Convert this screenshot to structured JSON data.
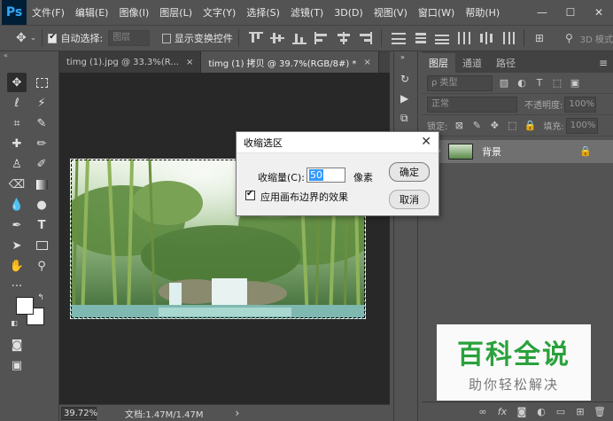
{
  "app": {
    "logo": "Ps"
  },
  "menu": [
    "文件(F)",
    "编辑(E)",
    "图像(I)",
    "图层(L)",
    "文字(Y)",
    "选择(S)",
    "滤镜(T)",
    "3D(D)",
    "视图(V)",
    "窗口(W)",
    "帮助(H)"
  ],
  "window_controls": {
    "minimize": "—",
    "maximize": "☐",
    "close": "✕"
  },
  "options": {
    "auto_select_label": "自动选择:",
    "auto_select_value": "图层",
    "show_transform_label": "显示变换控件",
    "mode_3d": "3D 模式"
  },
  "tabs": [
    {
      "label": "timg (1).jpg @ 33.3%(R...",
      "close": "×"
    },
    {
      "label": "timg (1) 拷贝 @ 39.7%(RGB/8#) *",
      "close": "×"
    }
  ],
  "status": {
    "zoom": "39.72%",
    "doc_info": "文档:1.47M/1.47M",
    "arrow": "›"
  },
  "layers_panel": {
    "tabs": [
      "图层",
      "通道",
      "路径"
    ],
    "kind_filter": "ρ 类型",
    "blend_mode": "正常",
    "opacity_label": "不透明度:",
    "opacity_value": "100%",
    "lock_label": "锁定:",
    "fill_label": "填充:",
    "fill_value": "100%",
    "layers": [
      {
        "name": "背景",
        "locked": true
      }
    ],
    "footer_icons": [
      "link-icon",
      "fx-icon",
      "mask-icon",
      "adjustment-icon",
      "group-icon",
      "new-layer-icon",
      "delete-icon"
    ]
  },
  "dialog": {
    "title": "收缩选区",
    "contract_label": "收缩量(C):",
    "contract_value": "50",
    "unit": "像素",
    "apply_edge_label": "应用画布边界的效果",
    "apply_edge_checked": true,
    "ok": "确定",
    "cancel": "取消"
  },
  "watermark": {
    "main": "百科全说",
    "sub": "助你轻松解决"
  }
}
